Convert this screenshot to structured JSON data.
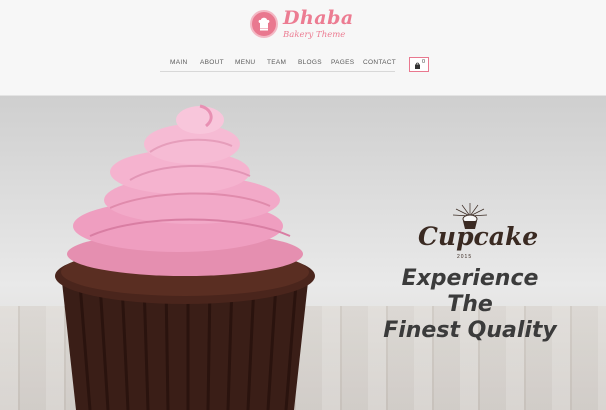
{
  "header": {
    "logo": {
      "name": "Dhaba",
      "tagline": "Bakery Theme"
    },
    "nav": [
      "MAIN",
      "ABOUT",
      "MENU",
      "TEAM",
      "BLOGS",
      "PAGES",
      "CONTACT"
    ],
    "cart": {
      "count": "0",
      "icon": "shopping-bag-icon"
    }
  },
  "hero": {
    "brand": "Cupcake",
    "year": "2015",
    "headline_line1": "Experience The",
    "headline_line2": "Finest Quality"
  },
  "colors": {
    "brand_pink": "#ec7c92",
    "text_dark": "#3b3b3b"
  }
}
